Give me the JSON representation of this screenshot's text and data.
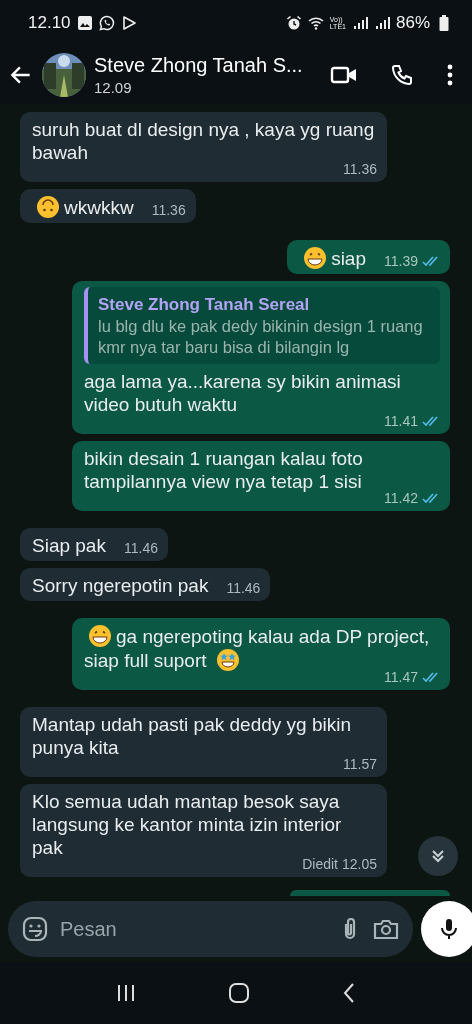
{
  "status_bar": {
    "time": "12.10",
    "volte_top": "Vo))",
    "volte_bottom": "LTE1",
    "battery": "86%"
  },
  "header": {
    "name": "Steve Zhong Tanah S...",
    "last_seen": "12.09"
  },
  "messages": [
    {
      "kind": "received",
      "text": "suruh buat dl design nya , kaya yg ruang bawah",
      "time": "11.36"
    },
    {
      "kind": "received",
      "emoji_before": {
        "kind": "upside-down"
      },
      "text": "wkwkkw",
      "time": "11.36"
    },
    {
      "kind": "sent",
      "emoji_before": {
        "kind": "grin"
      },
      "text": "siap",
      "time": "11.39",
      "read": true
    },
    {
      "kind": "sent",
      "quote": {
        "author": "Steve Zhong Tanah Sereal",
        "text": "lu blg dlu ke pak dedy bikinin design 1 ruang kmr nya tar baru bisa di bilangin lg"
      },
      "text": "aga lama ya...karena sy bikin animasi video butuh waktu",
      "time": "11.41",
      "read": true
    },
    {
      "kind": "sent",
      "text": "bikin desain 1 ruangan kalau foto tampilannya view nya tetap 1 sisi",
      "time": "11.42",
      "read": true
    },
    {
      "kind": "received",
      "text": "Siap pak",
      "time": "11.46"
    },
    {
      "kind": "received",
      "text": "Sorry ngerepotin pak",
      "time": "11.46"
    },
    {
      "kind": "sent",
      "emoji_before": {
        "kind": "grin"
      },
      "text": "ga ngerepoting kalau ada DP project, siap full suport",
      "emoji_after": {
        "kind": "star-eyes"
      },
      "time": "11.47",
      "read": true
    },
    {
      "kind": "received",
      "text": "Mantap udah pasti pak deddy yg bikin punya kita",
      "time": "11.57"
    },
    {
      "kind": "received",
      "text": "Klo semua udah mantap besok saya langsung ke kantor minta izin interior pak",
      "edited": "Diedit",
      "time": "12.05"
    }
  ],
  "composer": {
    "placeholder": "Pesan"
  }
}
